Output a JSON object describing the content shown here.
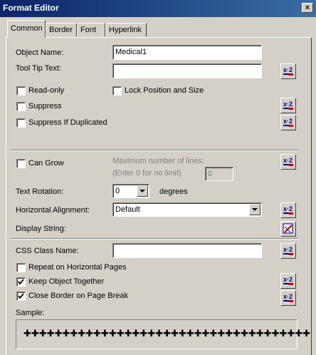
{
  "window": {
    "title": "Format Editor",
    "close_glyph": "×"
  },
  "tabs": [
    {
      "label": "Common",
      "active": true
    },
    {
      "label": "Border",
      "active": false
    },
    {
      "label": "Font",
      "active": false
    },
    {
      "label": "Hyperlink",
      "active": false
    }
  ],
  "fields": {
    "object_name_label": "Object Name:",
    "object_name_value": "Medical1",
    "tooltip_label": "Tool Tip Text:",
    "tooltip_value": "",
    "readonly_label": "Read-only",
    "lock_label": "Lock Position and Size",
    "suppress_label": "Suppress",
    "suppress_dup_label": "Suppress If Duplicated",
    "can_grow_label": "Can Grow",
    "max_lines_label": "Maximum number of lines:",
    "max_lines_hint": "(Enter 0 for no limit)",
    "max_lines_value": "0",
    "rotation_label": "Text Rotation:",
    "rotation_value": "0",
    "degrees_label": "degrees",
    "halign_label": "Horizontal Alignment:",
    "halign_value": "Default",
    "display_string_label": "Display String:",
    "css_label": "CSS Class Name:",
    "css_value": "",
    "repeat_label": "Repeat on Horizontal Pages",
    "keep_together_label": "Keep Object Together",
    "close_border_label": "Close Border on Page Break",
    "sample_label": "Sample:",
    "sample_text": "✚✚✚✚✚✚✚✚✚✚✚✚✚✚✚✚✚✚✚✚✚✚✚✚✚✚✚✚✚✚✚✚✚✚✚✚✚"
  },
  "checks": {
    "readonly": false,
    "lock": false,
    "suppress": false,
    "suppress_dup": false,
    "can_grow": false,
    "repeat": false,
    "keep_together": true,
    "close_border": true
  },
  "icons": {
    "formula": "formula-x2-icon",
    "display_string": "formula-edit-icon"
  },
  "colors": {
    "title_start": "#0a246a",
    "title_end": "#3a6ea5",
    "face": "#d4d0c8",
    "formula_blue": "#000080",
    "formula_red": "#c00000"
  }
}
